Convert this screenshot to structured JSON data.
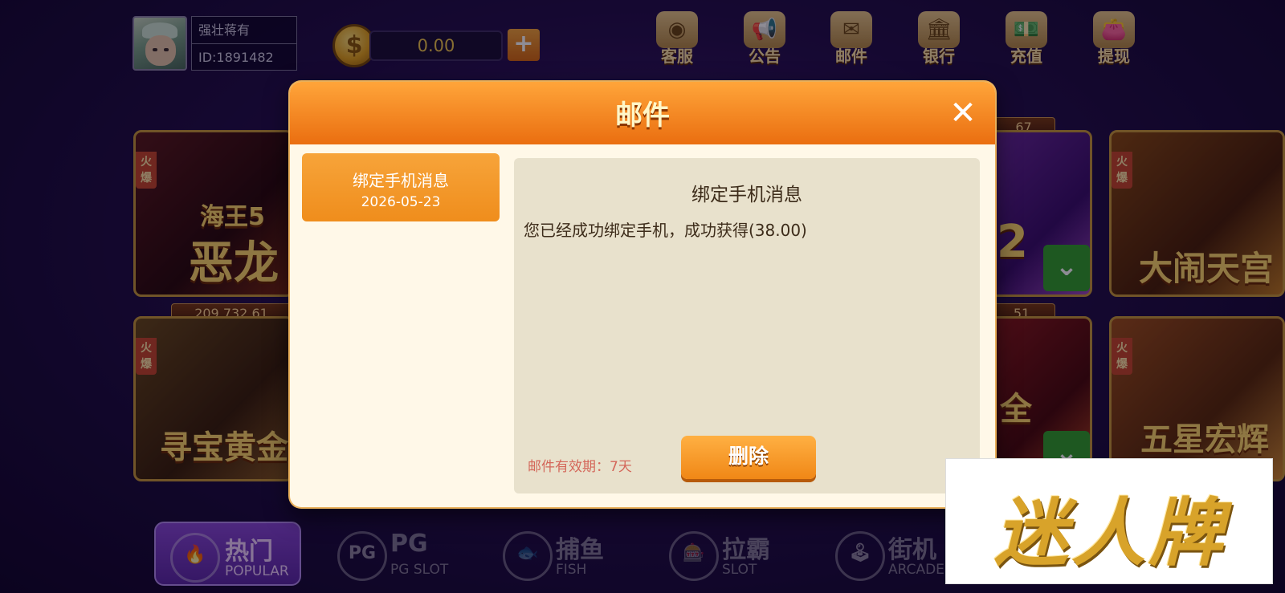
{
  "user": {
    "name": "强壮蒋有",
    "id_text": "ID:1891482"
  },
  "wallet": {
    "balance": "0.00",
    "coin_icon": "$",
    "add_label": "+"
  },
  "top_nav": [
    {
      "label": "客服",
      "icon": "robot-icon",
      "glyph": "◉"
    },
    {
      "label": "公告",
      "icon": "megaphone-icon",
      "glyph": "📢"
    },
    {
      "label": "邮件",
      "icon": "mail-icon",
      "glyph": "✉"
    },
    {
      "label": "银行",
      "icon": "bank-icon",
      "glyph": "🏛"
    },
    {
      "label": "充值",
      "icon": "cash-icon",
      "glyph": "💵"
    },
    {
      "label": "提现",
      "icon": "wallet-icon",
      "glyph": "👛"
    }
  ],
  "tiles": {
    "hot_label": "火爆",
    "t1": {
      "title": "恶龙",
      "sub": "海王5"
    },
    "t1_jackpot": "209,732.61",
    "t2": {
      "title": "寻宝黄金"
    },
    "t3_jackpot": ".67",
    "t3": {
      "title": "2"
    },
    "t4": {
      "title": "大闹天宫"
    },
    "t5_jackpot": "51",
    "t5": {
      "title": "全"
    },
    "t6": {
      "title": "五星宏辉"
    },
    "download_glyph": "⌄"
  },
  "bottom_tabs": [
    {
      "label": "热门",
      "sub": "POPULAR",
      "glyph": "🔥"
    },
    {
      "label": "PG",
      "sub": "PG SLOT",
      "glyph": "PG"
    },
    {
      "label": "捕鱼",
      "sub": "FISH",
      "glyph": "🐟"
    },
    {
      "label": "拉霸",
      "sub": "SLOT",
      "glyph": "🎰"
    },
    {
      "label": "街机",
      "sub": "ARCADE",
      "glyph": "🕹"
    }
  ],
  "modal": {
    "title": "邮件",
    "close_glyph": "✕",
    "mail_list": [
      {
        "title": "绑定手机消息",
        "date": "2026-05-23"
      }
    ],
    "detail": {
      "subject": "绑定手机消息",
      "body": "您已经成功绑定手机，成功获得(38.00)",
      "expiry": "邮件有效期：7天",
      "delete_label": "删除"
    }
  },
  "watermark": {
    "text": "迷人牌"
  },
  "colors": {
    "modal_header": "#f08a1e",
    "accent_gold": "#ffd96a",
    "expiry_red": "#d4675a"
  }
}
